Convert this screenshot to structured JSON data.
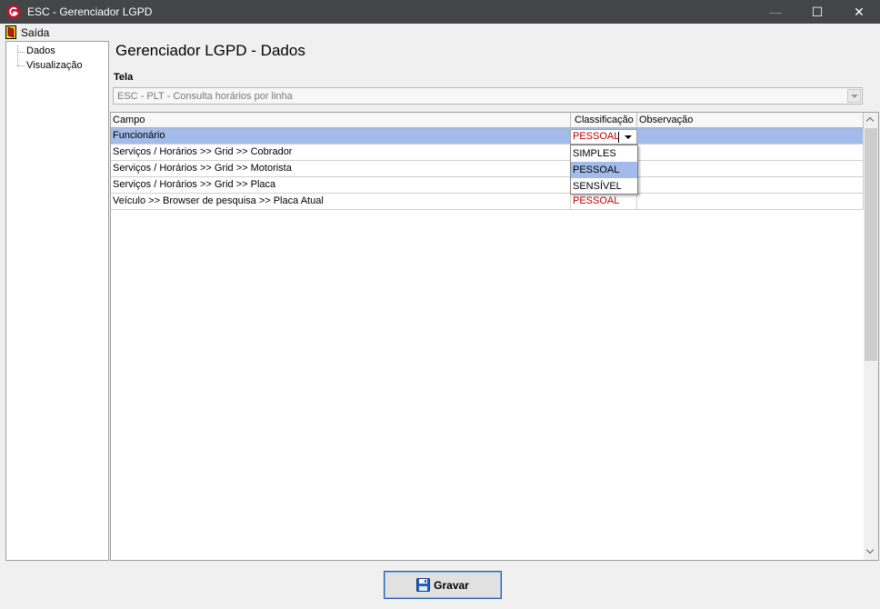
{
  "window": {
    "title": "ESC - Gerenciador LGPD",
    "minimize": "—",
    "maximize": "☐",
    "close": "✕"
  },
  "menu": {
    "exit_label": "Saída"
  },
  "tree": {
    "items": [
      {
        "label": "Dados"
      },
      {
        "label": "Visualização"
      }
    ]
  },
  "page": {
    "title": "Gerenciador LGPD - Dados"
  },
  "tela": {
    "label": "Tela",
    "value": "ESC - PLT - Consulta horários por linha"
  },
  "grid": {
    "columns": [
      "Campo",
      "Classificação",
      "Observação"
    ],
    "rows": [
      {
        "campo": "Funcionário",
        "classificacao": "PESSOAL",
        "observacao": "",
        "selected": true
      },
      {
        "campo": "Serviços / Horários >> Grid >> Cobrador",
        "classificacao": "",
        "observacao": ""
      },
      {
        "campo": "Serviços / Horários >> Grid >> Motorista",
        "classificacao": "",
        "observacao": ""
      },
      {
        "campo": "Serviços / Horários >> Grid >> Placa",
        "classificacao": "",
        "observacao": ""
      },
      {
        "campo": "Veículo >> Browser de pesquisa >> Placa Atual",
        "classificacao": "PESSOAL",
        "observacao": ""
      }
    ],
    "editor_value": "PESSOAL",
    "dropdown_options": [
      "SIMPLES",
      "PESSOAL",
      "SENSÍVEL"
    ],
    "dropdown_highlighted": "PESSOAL"
  },
  "footer": {
    "save_label": "Gravar"
  },
  "colors": {
    "titlebar": "#444546",
    "selection": "#a3bbea",
    "classification_text": "#c00000"
  }
}
